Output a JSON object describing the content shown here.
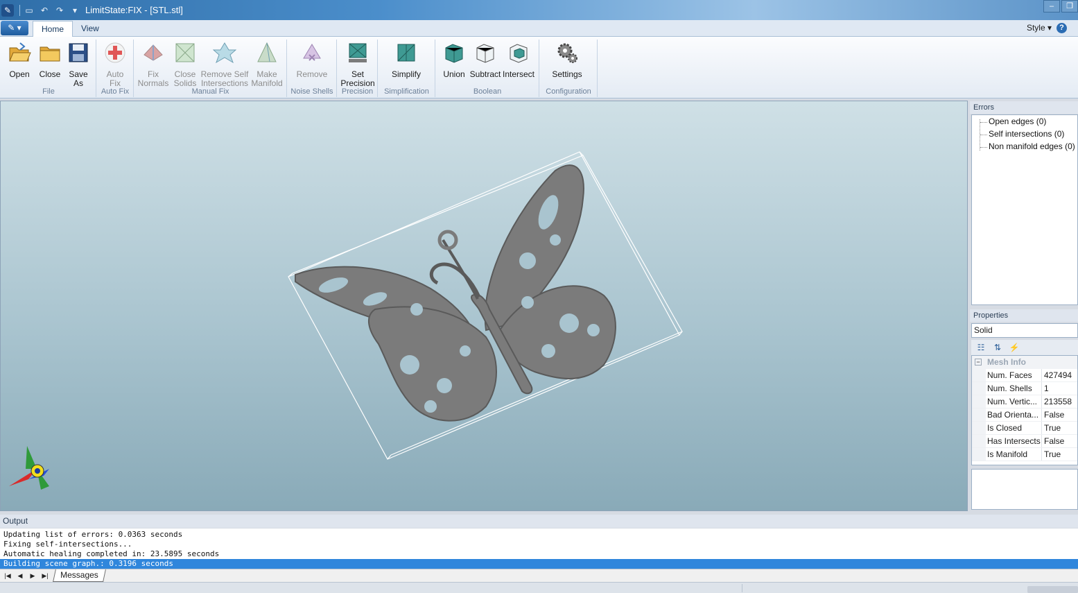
{
  "window": {
    "title": "LimitState:FIX - [STL.stl]",
    "app_icon": "wrench-icon"
  },
  "quick_access": [
    "folder-open-icon",
    "undo-icon",
    "redo-icon",
    "dropdown-icon"
  ],
  "ribbon": {
    "tabs": [
      {
        "label": "Home",
        "active": true
      },
      {
        "label": "View",
        "active": false
      }
    ],
    "style_label": "Style",
    "groups": [
      {
        "label": "File",
        "buttons": [
          {
            "label": "Open",
            "icon": "folder-open-icon"
          },
          {
            "label": "Close",
            "icon": "folder-close-icon"
          },
          {
            "label": "Save As",
            "icon": "save-icon"
          }
        ]
      },
      {
        "label": "Auto Fix",
        "buttons": [
          {
            "label": "Auto Fix",
            "icon": "auto-fix-icon"
          }
        ]
      },
      {
        "label": "Manual Fix",
        "buttons": [
          {
            "label": "Fix Normals",
            "icon": "fix-normals-icon"
          },
          {
            "label": "Close Solids",
            "icon": "close-solids-icon"
          },
          {
            "label": "Remove Self Intersections",
            "icon": "remove-intersections-icon"
          },
          {
            "label": "Make Manifold",
            "icon": "make-manifold-icon"
          }
        ]
      },
      {
        "label": "Noise Shells",
        "buttons": [
          {
            "label": "Remove",
            "icon": "remove-shells-icon"
          }
        ]
      },
      {
        "label": "Precision",
        "buttons": [
          {
            "label": "Set Precision",
            "icon": "precision-icon"
          }
        ]
      },
      {
        "label": "Simplification",
        "buttons": [
          {
            "label": "Simplify",
            "icon": "simplify-icon"
          }
        ]
      },
      {
        "label": "Boolean",
        "buttons": [
          {
            "label": "Union",
            "icon": "union-icon"
          },
          {
            "label": "Subtract",
            "icon": "subtract-icon"
          },
          {
            "label": "Intersect",
            "icon": "intersect-icon"
          }
        ]
      },
      {
        "label": "Configuration",
        "buttons": [
          {
            "label": "Settings",
            "icon": "gear-icon"
          }
        ]
      }
    ]
  },
  "errors": {
    "header": "Errors",
    "items": [
      "Open edges (0)",
      "Self intersections (0)",
      "Non manifold edges (0)"
    ]
  },
  "properties": {
    "header": "Properties",
    "object_type": "Solid",
    "category": "Mesh Info",
    "rows": [
      {
        "name": "Num. Faces",
        "value": "427494"
      },
      {
        "name": "Num. Shells",
        "value": "1"
      },
      {
        "name": "Num. Vertic...",
        "value": "213558"
      },
      {
        "name": "Bad Orienta...",
        "value": "False"
      },
      {
        "name": "Is Closed",
        "value": "True"
      },
      {
        "name": "Has Intersects",
        "value": "False"
      },
      {
        "name": "Is Manifold",
        "value": "True"
      }
    ]
  },
  "output": {
    "header": "Output",
    "lines": [
      "Updating list of errors: 0.0363 seconds",
      "Fixing self-intersections...",
      "Automatic healing completed in: 23.5895 seconds",
      "Building scene graph.: 0.3196 seconds"
    ],
    "selected_line": 3,
    "tab_label": "Messages"
  },
  "viewport": {
    "model": "butterfly-mesh",
    "model_color": "#7b7b7b",
    "background_top": "#cfe0e6",
    "background_bottom": "#89aab8"
  }
}
